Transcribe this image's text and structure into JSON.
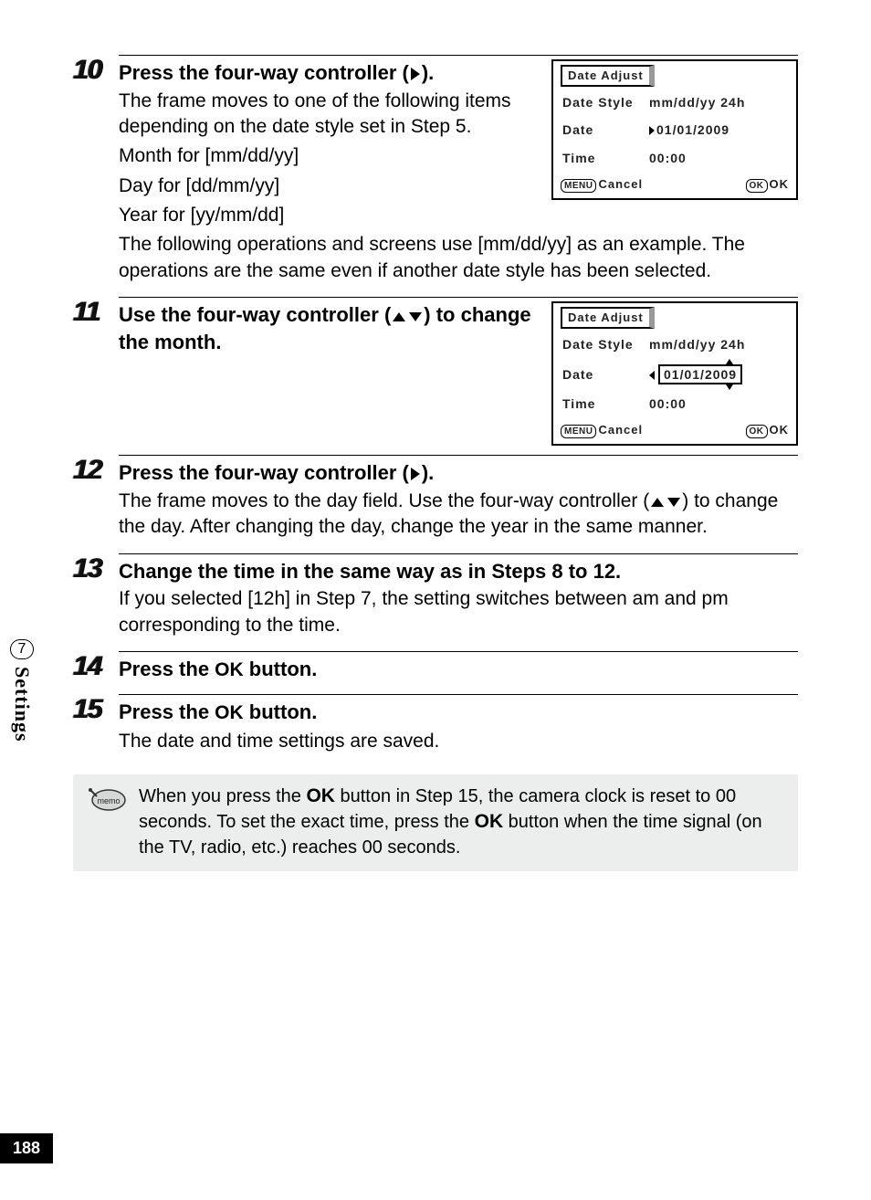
{
  "sidebar": {
    "chapter_no": "7",
    "chapter_label": "Settings"
  },
  "page_number": "188",
  "steps": {
    "s10": {
      "no": "10",
      "title_pre": "Press the four-way controller (",
      "title_post": ").",
      "p1": "The frame moves to one of the following items depending on the date style set in Step 5.",
      "li1": "Month for [mm/dd/yy]",
      "li2": "Day for [dd/mm/yy]",
      "li3": "Year for [yy/mm/dd]",
      "p2": "The following operations and screens use [mm/dd/yy] as an example. The operations are the same even if another date style has been selected."
    },
    "s11": {
      "no": "11",
      "title_pre": "Use the four-way controller (",
      "title_post": ") to change the month."
    },
    "s12": {
      "no": "12",
      "title_pre": "Press the four-way controller (",
      "title_post": ").",
      "p1_a": "The frame moves to the day field. Use the four-way controller (",
      "p1_b": ") to change the day. After changing the day, change the year in the same manner."
    },
    "s13": {
      "no": "13",
      "title": "Change the time in the same way as in Steps 8 to 12.",
      "p1": "If you selected [12h] in Step 7, the setting switches between am and pm corresponding to the time."
    },
    "s14": {
      "no": "14",
      "title_pre": "Press the ",
      "title_ok": "OK",
      "title_post": " button."
    },
    "s15": {
      "no": "15",
      "title_pre": "Press the ",
      "title_ok": "OK",
      "title_post": " button.",
      "p1": "The date and time settings are saved."
    }
  },
  "memo": {
    "label": "memo",
    "p_a": "When you press the ",
    "ok1": "OK",
    "p_b": " button in Step 15, the camera clock is reset to 00 seconds. To set the exact time, press the ",
    "ok2": "OK",
    "p_c": " button when the time signal (on the TV, radio, etc.) reaches 00 seconds."
  },
  "lcd": {
    "title": "Date Adjust",
    "style_label": "Date Style",
    "style_value": "mm/dd/yy  24h",
    "date_label": "Date",
    "date_value_a": "01/01/2009",
    "date_value_b_pre": "01/01/",
    "date_value_b_year": "2009",
    "time_label": "Time",
    "time_value": "00:00",
    "menu_btn": "MENU",
    "cancel": "Cancel",
    "ok_btn": "OK",
    "ok_label": "OK"
  }
}
